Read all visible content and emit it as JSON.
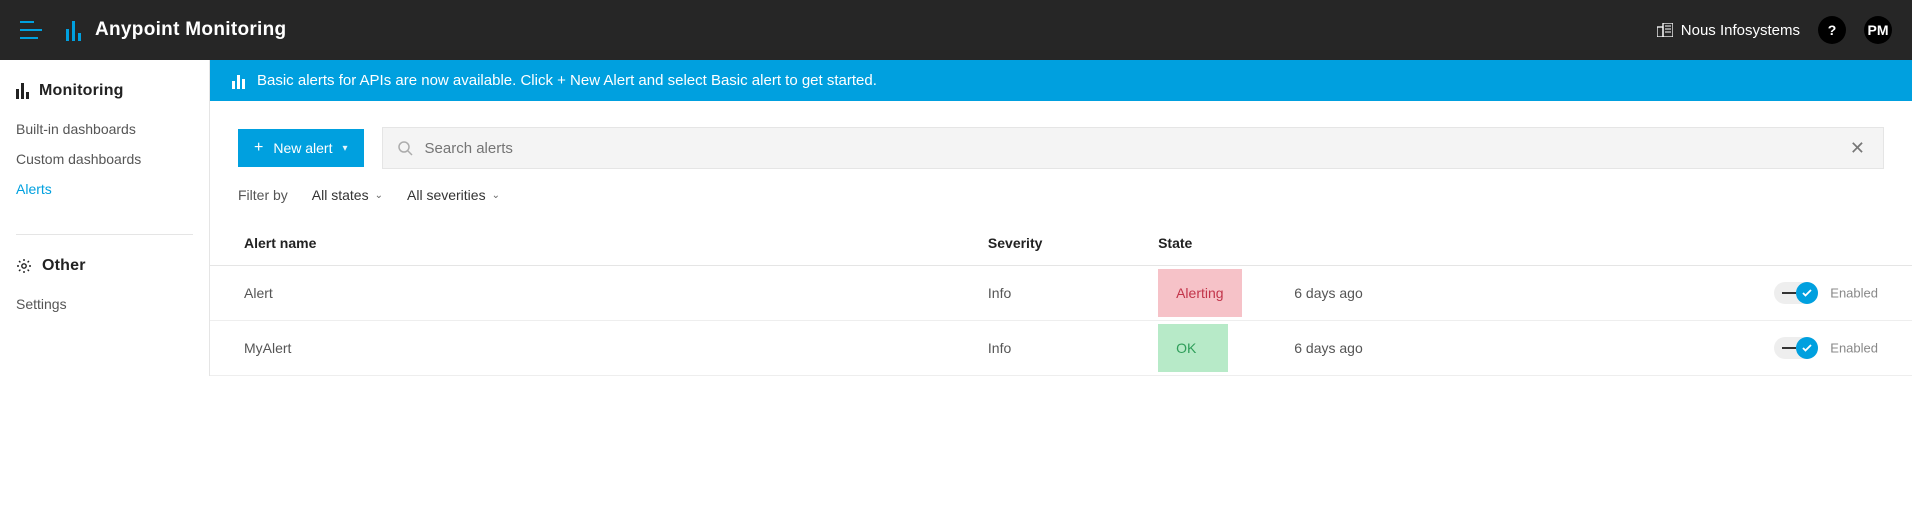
{
  "header": {
    "app_title": "Anypoint Monitoring",
    "org_name": "Nous Infosystems",
    "help_label": "?",
    "user_initials": "PM"
  },
  "sidebar": {
    "sections": [
      {
        "title": "Monitoring",
        "items": [
          {
            "label": "Built-in dashboards",
            "active": false
          },
          {
            "label": "Custom dashboards",
            "active": false
          },
          {
            "label": "Alerts",
            "active": true
          }
        ]
      },
      {
        "title": "Other",
        "items": [
          {
            "label": "Settings",
            "active": false
          }
        ]
      }
    ]
  },
  "banner": {
    "text": "Basic alerts for APIs are now available. Click + New Alert and select Basic alert to get started."
  },
  "toolbar": {
    "new_alert_label": "New alert",
    "search_placeholder": "Search alerts"
  },
  "filters": {
    "label": "Filter by",
    "state_filter": "All states",
    "severity_filter": "All severities"
  },
  "table": {
    "columns": {
      "name": "Alert name",
      "severity": "Severity",
      "state": "State"
    },
    "toggle_label": "Enabled",
    "rows": [
      {
        "name": "Alert",
        "severity": "Info",
        "state": "Alerting",
        "state_class": "state-alerting",
        "time": "6 days ago",
        "enabled": true
      },
      {
        "name": "MyAlert",
        "severity": "Info",
        "state": "OK",
        "state_class": "state-ok",
        "time": "6 days ago",
        "enabled": true
      }
    ]
  }
}
